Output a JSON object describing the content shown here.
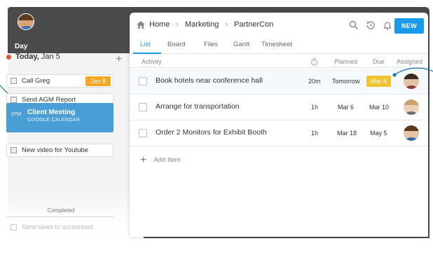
{
  "left": {
    "view_label": "Day",
    "today_label": "Today,",
    "today_date": "Jan 5",
    "tasks": [
      {
        "label": "Call Greg",
        "badge": "Jan 8"
      },
      {
        "label": "Send AGM Report"
      },
      {
        "label": "New video for Youtube"
      }
    ],
    "meeting": {
      "time": "1PM",
      "title": "Client Meeting",
      "source": "GOOGLE CALENDAR"
    },
    "completed_label": "Completed",
    "completed_task": "Send taxes to accountant"
  },
  "breadcrumb": [
    "Home",
    "Marketing",
    "PartnerCon"
  ],
  "new_button": "NEW",
  "tabs": [
    "List",
    "Board",
    "Files",
    "Gantt",
    "Timesheet"
  ],
  "active_tab": "List",
  "columns": {
    "activity": "Activity",
    "planned": "Planned",
    "due": "Due",
    "assigned": "Assigned"
  },
  "rows": [
    {
      "title": "Book hotels near conference hall",
      "estimate": "20m",
      "planned": "Tomorrow",
      "due": "Mar 4"
    },
    {
      "title": "Arrange for transportation",
      "estimate": "1h",
      "planned": "Mar 6",
      "due": "Mar 10"
    },
    {
      "title": "Order 2 Monitors for Exhibit Booth",
      "estimate": "1h",
      "planned": "Mar 18",
      "due": "May 5"
    }
  ],
  "add_item_label": "Add Item",
  "colors": {
    "accent": "#1a9be9",
    "today_dot": "#e4572e",
    "task_badge": "#f5a623",
    "due_badge": "#f2c230",
    "meeting": "#4a9ed6"
  }
}
